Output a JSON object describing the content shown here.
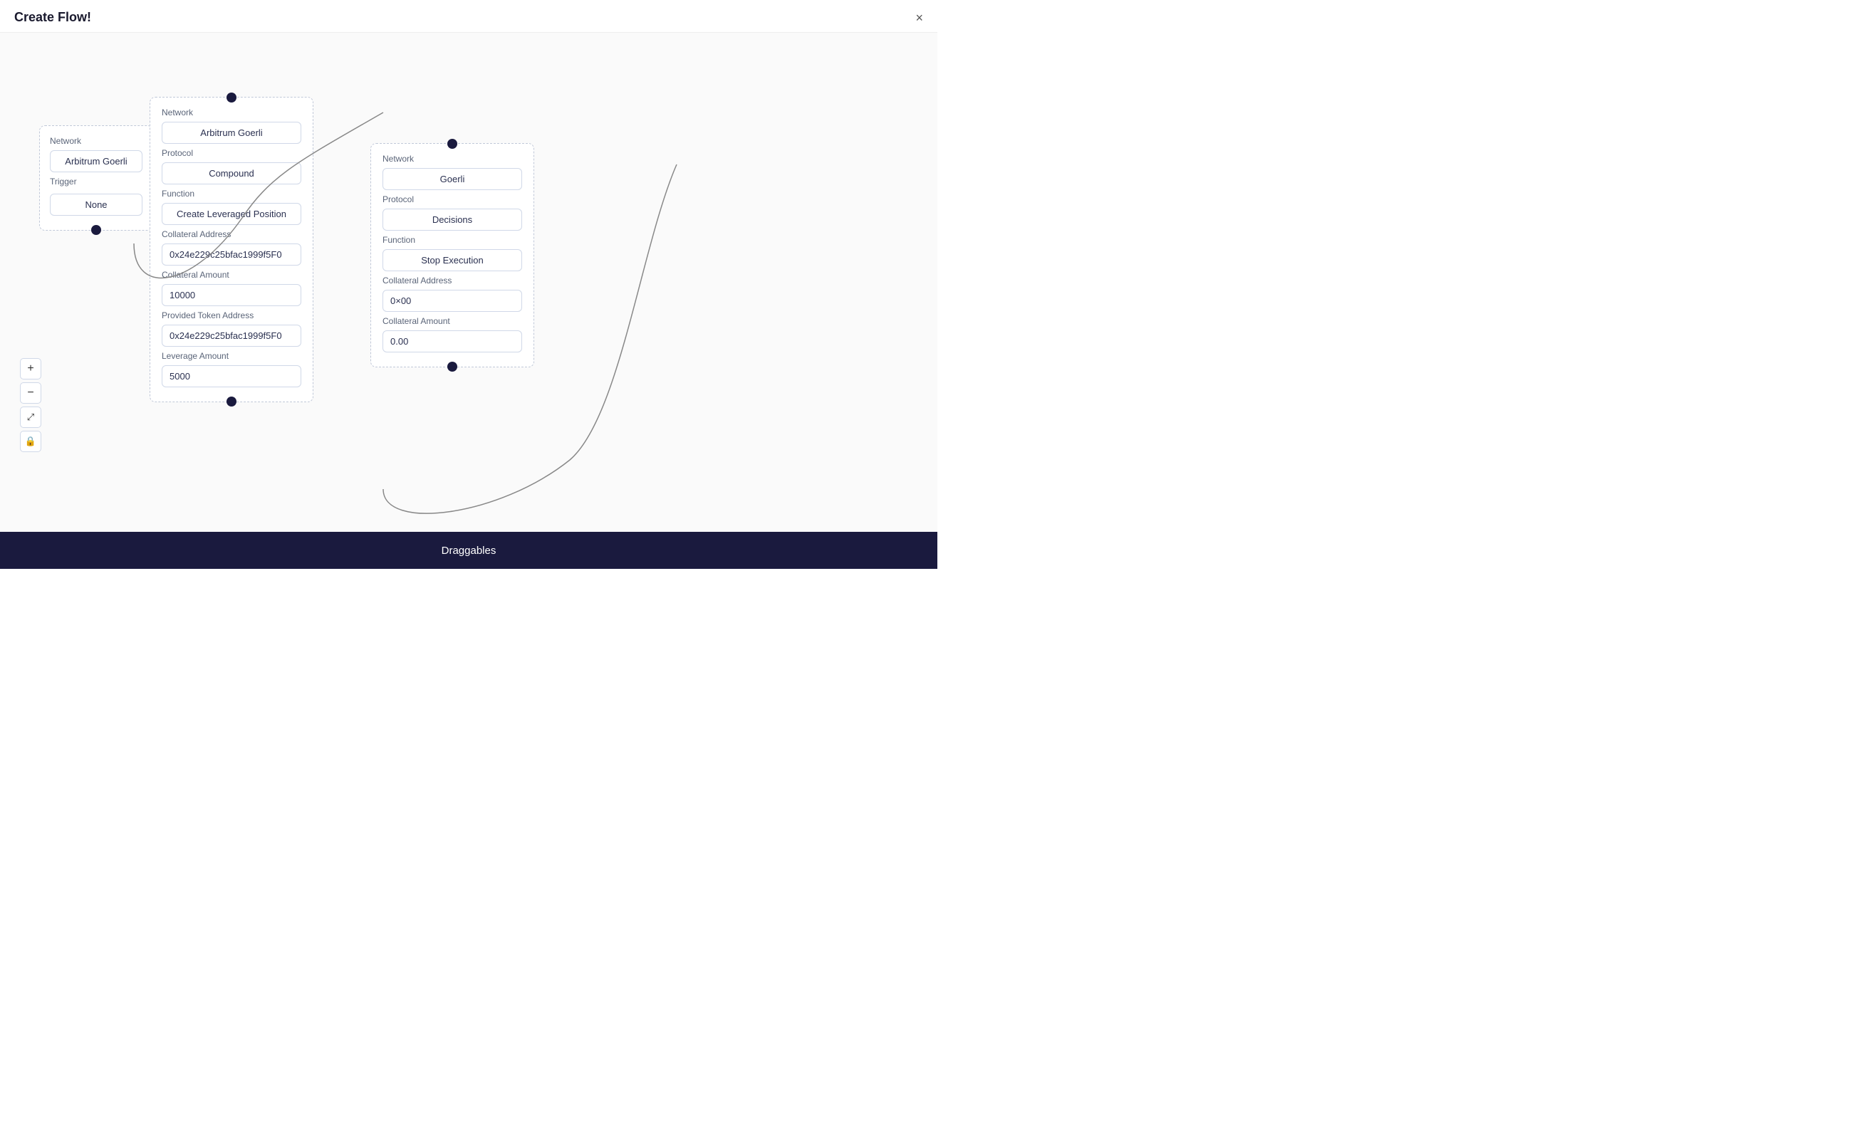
{
  "header": {
    "title": "Create Flow!",
    "close_label": "×"
  },
  "node_trigger": {
    "network_label": "Network",
    "network_value": "Arbitrum Goerli",
    "trigger_label": "Trigger",
    "trigger_value": "None"
  },
  "node_compound": {
    "network_label": "Network",
    "network_value": "Arbitrum Goerli",
    "protocol_label": "Protocol",
    "protocol_value": "Compound",
    "function_label": "Function",
    "function_value": "Create Leveraged Position",
    "collateral_address_label": "Collateral Address",
    "collateral_address_value": "0x24e229c25bfac1999f5F0",
    "collateral_amount_label": "Collateral Amount",
    "collateral_amount_value": "10000",
    "provided_token_label": "Provided Token Address",
    "provided_token_value": "0x24e229c25bfac1999f5F0",
    "leverage_amount_label": "Leverage Amount",
    "leverage_amount_value": "5000"
  },
  "node_decisions": {
    "network_label": "Network",
    "network_value": "Goerli",
    "protocol_label": "Protocol",
    "protocol_value": "Decisions",
    "function_label": "Function",
    "function_value": "Stop Execution",
    "collateral_address_label": "Collateral Address",
    "collateral_address_value": "0×00",
    "collateral_amount_label": "Collateral Amount",
    "collateral_amount_value": "0.00"
  },
  "zoom_controls": {
    "zoom_in": "+",
    "zoom_out": "−",
    "fit": "⤢",
    "lock": "🔒"
  },
  "bottom_bar": {
    "label": "Draggables"
  }
}
